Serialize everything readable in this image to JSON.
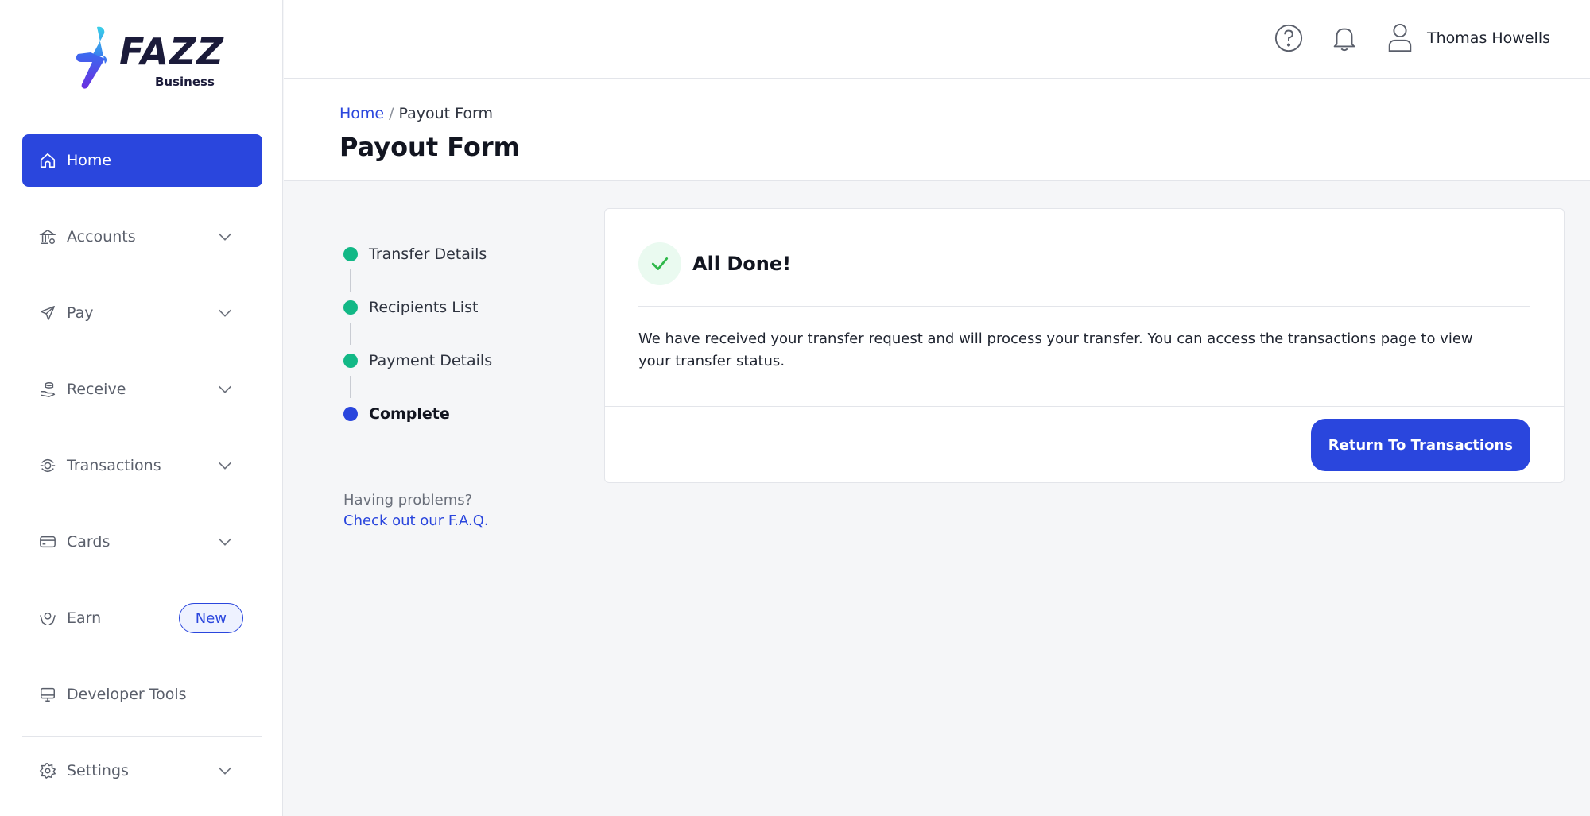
{
  "brand": {
    "name": "FAZZ",
    "sub": "Business"
  },
  "colors": {
    "primary": "#2a46dd",
    "success": "#12b886",
    "text": "#1f2430"
  },
  "sidebar": {
    "items": [
      {
        "label": "Home",
        "icon": "home-icon",
        "active": true
      },
      {
        "label": "Accounts",
        "icon": "bank-icon",
        "expandable": true
      },
      {
        "label": "Pay",
        "icon": "send-icon",
        "expandable": true
      },
      {
        "label": "Receive",
        "icon": "hand-coin-icon",
        "expandable": true
      },
      {
        "label": "Transactions",
        "icon": "transactions-icon",
        "expandable": true
      },
      {
        "label": "Cards",
        "icon": "card-icon",
        "expandable": true
      },
      {
        "label": "Earn",
        "icon": "earn-icon",
        "badge": "New"
      },
      {
        "label": "Developer Tools",
        "icon": "monitor-icon"
      }
    ],
    "settings": {
      "label": "Settings",
      "icon": "gear-icon",
      "expandable": true
    }
  },
  "header": {
    "help_icon": "help-icon",
    "notification_icon": "bell-icon",
    "user_icon": "user-icon",
    "user_name": "Thomas Howells"
  },
  "breadcrumb": {
    "home": "Home",
    "separator": "/",
    "current": "Payout Form"
  },
  "page_title": "Payout Form",
  "stepper": {
    "steps": [
      {
        "label": "Transfer Details",
        "status": "done"
      },
      {
        "label": "Recipients List",
        "status": "done"
      },
      {
        "label": "Payment Details",
        "status": "done"
      },
      {
        "label": "Complete",
        "status": "current"
      }
    ]
  },
  "help": {
    "question": "Having problems?",
    "link": "Check out our F.A.Q."
  },
  "card": {
    "title": "All Done!",
    "message": "We have received your transfer request and will process your transfer. You can access the transactions page to view your transfer status.",
    "button": "Return To Transactions"
  }
}
